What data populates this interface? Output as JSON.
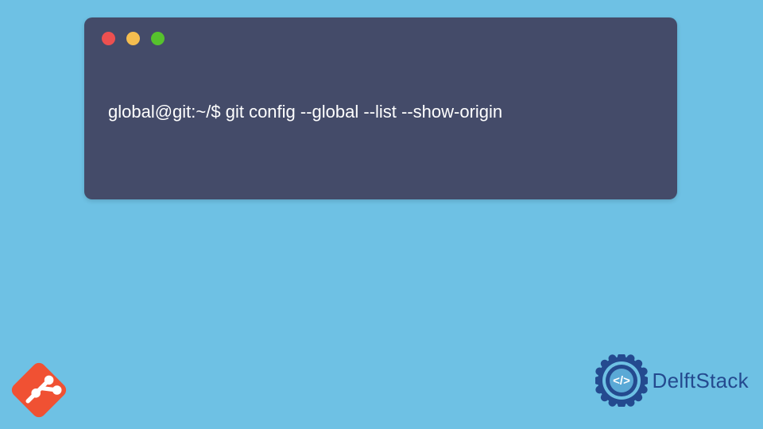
{
  "terminal": {
    "prompt": "global@git:~/$",
    "command": "git config --global --list --show-origin"
  },
  "branding": {
    "delftstack_label": "DelftStack"
  },
  "colors": {
    "background": "#6ec1e4",
    "terminal_bg": "#444b69",
    "traffic_red": "#ec5050",
    "traffic_yellow": "#f4bd4f",
    "traffic_green": "#56c22d",
    "git_orange": "#f05133",
    "delft_blue": "#244a8f"
  },
  "icons": {
    "git": "git-icon",
    "delftstack_medallion": "medallion-icon"
  }
}
